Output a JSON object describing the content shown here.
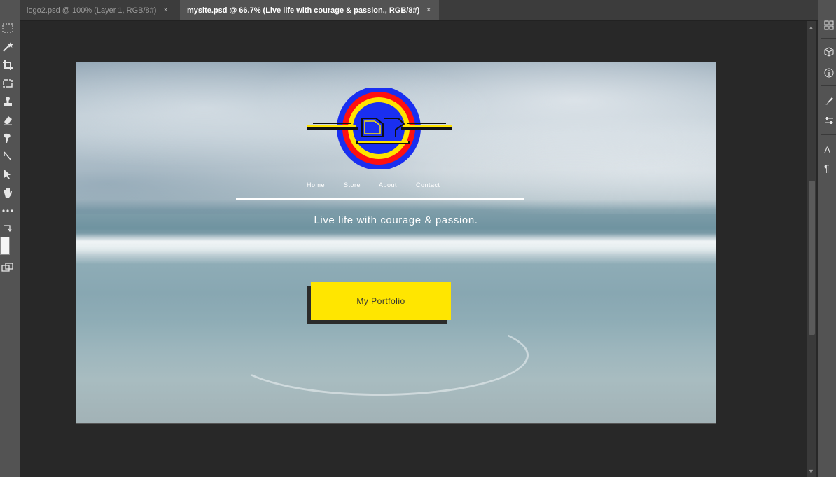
{
  "tabs": [
    {
      "label": "logo2.psd @ 100% (Layer 1, RGB/8#)",
      "close": "×",
      "active": false
    },
    {
      "label": "mysite.psd @ 66.7% (Live life with courage & passion., RGB/8#)",
      "close": "×",
      "active": true
    }
  ],
  "tools": [
    "marquee-icon",
    "magic-wand-icon",
    "crop-icon",
    "frame-icon",
    "stamp-icon",
    "eraser-icon",
    "smudge-icon",
    "pen-icon",
    "selection-arrow-icon",
    "hand-icon",
    "more-tools-icon",
    "swap-colors-icon",
    "screen-mode-icon"
  ],
  "document": {
    "nav": [
      "Home",
      "Store",
      "About",
      "Contact"
    ],
    "tagline": "Live life with courage & passion.",
    "button_label": "My Portfolio",
    "colors": {
      "button": "#ffe600",
      "logo_outer": "#1a2ff0",
      "logo_ring_red": "#ff1010",
      "logo_ring_yellow": "#ffe400"
    }
  },
  "right_panel": {
    "icons": [
      "panel-grid-icon",
      "3d-cube-icon",
      "info-icon",
      "brush-settings-icon",
      "adjustments-icon",
      "character-icon",
      "paragraph-icon"
    ],
    "char_label": "A",
    "para_label": "¶"
  },
  "scrollbar": {
    "up": "▲",
    "down": "▼"
  }
}
